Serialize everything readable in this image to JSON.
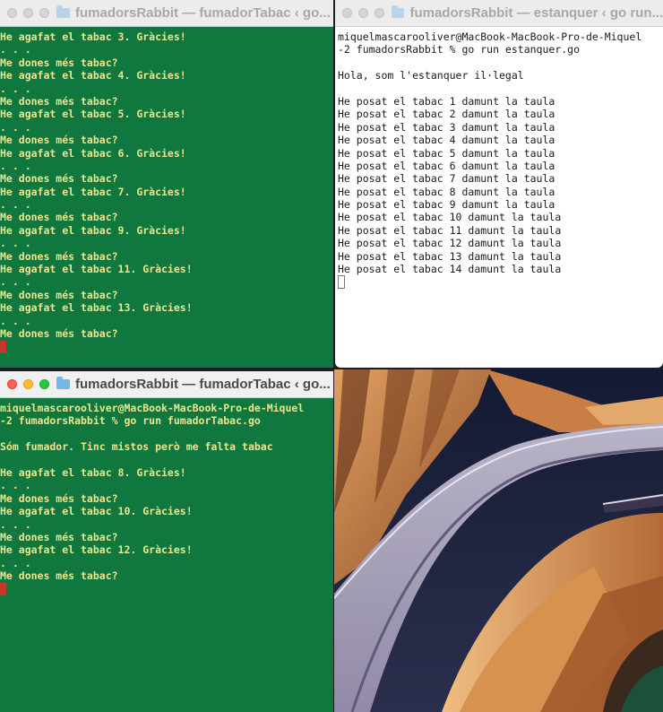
{
  "win_top_left": {
    "title": "fumadorsRabbit — fumadorTabac ‹ go...",
    "lines": [
      "He agafat el tabac 3. Gràcies!",
      ". . .",
      "Me dones més tabac?",
      "He agafat el tabac 4. Gràcies!",
      ". . .",
      "Me dones més tabac?",
      "He agafat el tabac 5. Gràcies!",
      ". . .",
      "Me dones més tabac?",
      "He agafat el tabac 6. Gràcies!",
      ". . .",
      "Me dones més tabac?",
      "He agafat el tabac 7. Gràcies!",
      ". . .",
      "Me dones més tabac?",
      "He agafat el tabac 9. Gràcies!",
      ". . .",
      "Me dones més tabac?",
      "He agafat el tabac 11. Gràcies!",
      ". . .",
      "Me dones més tabac?",
      "He agafat el tabac 13. Gràcies!",
      ". . .",
      "Me dones més tabac?"
    ]
  },
  "win_top_right": {
    "title": "fumadorsRabbit — estanquer ‹ go run...",
    "lines": [
      "miquelmascarooliver@MacBook-MacBook-Pro-de-Miquel",
      "-2 fumadorsRabbit % go run estanquer.go",
      "",
      "Hola, som l'estanquer il·legal",
      "",
      "He posat el tabac 1 damunt la taula",
      "He posat el tabac 2 damunt la taula",
      "He posat el tabac 3 damunt la taula",
      "He posat el tabac 4 damunt la taula",
      "He posat el tabac 5 damunt la taula",
      "He posat el tabac 6 damunt la taula",
      "He posat el tabac 7 damunt la taula",
      "He posat el tabac 8 damunt la taula",
      "He posat el tabac 9 damunt la taula",
      "He posat el tabac 10 damunt la taula",
      "He posat el tabac 11 damunt la taula",
      "He posat el tabac 12 damunt la taula",
      "He posat el tabac 13 damunt la taula",
      "He posat el tabac 14 damunt la taula"
    ]
  },
  "win_bottom_left": {
    "title": "fumadorsRabbit — fumadorTabac ‹ go...",
    "lines": [
      "miquelmascarooliver@MacBook-MacBook-Pro-de-Miquel",
      "-2 fumadorsRabbit % go run fumadorTabac.go",
      "",
      "Sóm fumador. Tinc mistos però me falta tabac",
      "",
      "He agafat el tabac 8. Gràcies!",
      ". . .",
      "Me dones més tabac?",
      "He agafat el tabac 10. Gràcies!",
      ". . .",
      "Me dones més tabac?",
      "He agafat el tabac 12. Gràcies!",
      ". . .",
      "Me dones més tabac?"
    ]
  },
  "colors": {
    "terminal_green": "#10783e",
    "terminal_text": "#ece58f",
    "cursor_red": "#c0392b"
  }
}
